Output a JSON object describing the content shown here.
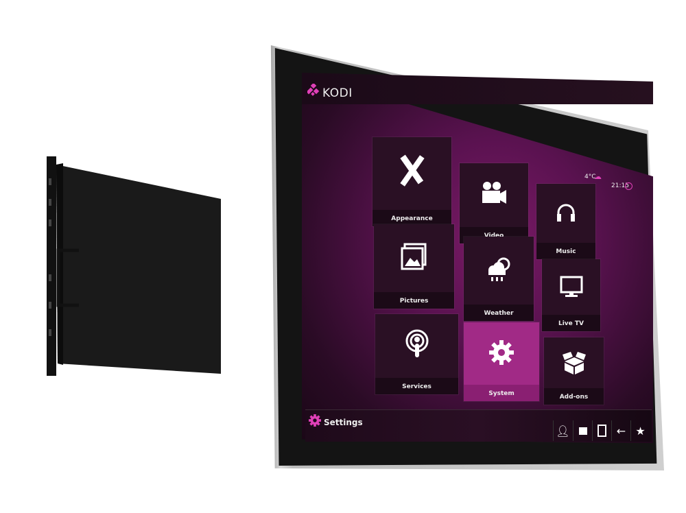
{
  "app": {
    "title": "KODI",
    "accent_color": "#e040b8"
  },
  "status": {
    "temperature": "4°C",
    "weather_icon": "weather-icon",
    "time": "21:15",
    "clock_icon": "clock-icon"
  },
  "tiles": [
    {
      "label": "Appearance",
      "icon": "pencil-ruler-icon"
    },
    {
      "label": "Video",
      "icon": "video-camera-icon"
    },
    {
      "label": "Music",
      "icon": "headphones-icon"
    },
    {
      "label": "Pictures",
      "icon": "pictures-icon"
    },
    {
      "label": "Weather",
      "icon": "weather-cloud-icon"
    },
    {
      "label": "Live TV",
      "icon": "tv-icon"
    },
    {
      "label": "Services",
      "icon": "podcast-icon"
    },
    {
      "label": "System",
      "icon": "gear-wrench-icon",
      "selected": true
    },
    {
      "label": "Add-ons",
      "icon": "box-icon"
    }
  ],
  "footer": {
    "title": "Settings",
    "icon": "gear-icon",
    "buttons": [
      "profile-icon",
      "folder-icon",
      "presentation-icon",
      "back-arrow-icon",
      "favourites-star-icon"
    ]
  }
}
